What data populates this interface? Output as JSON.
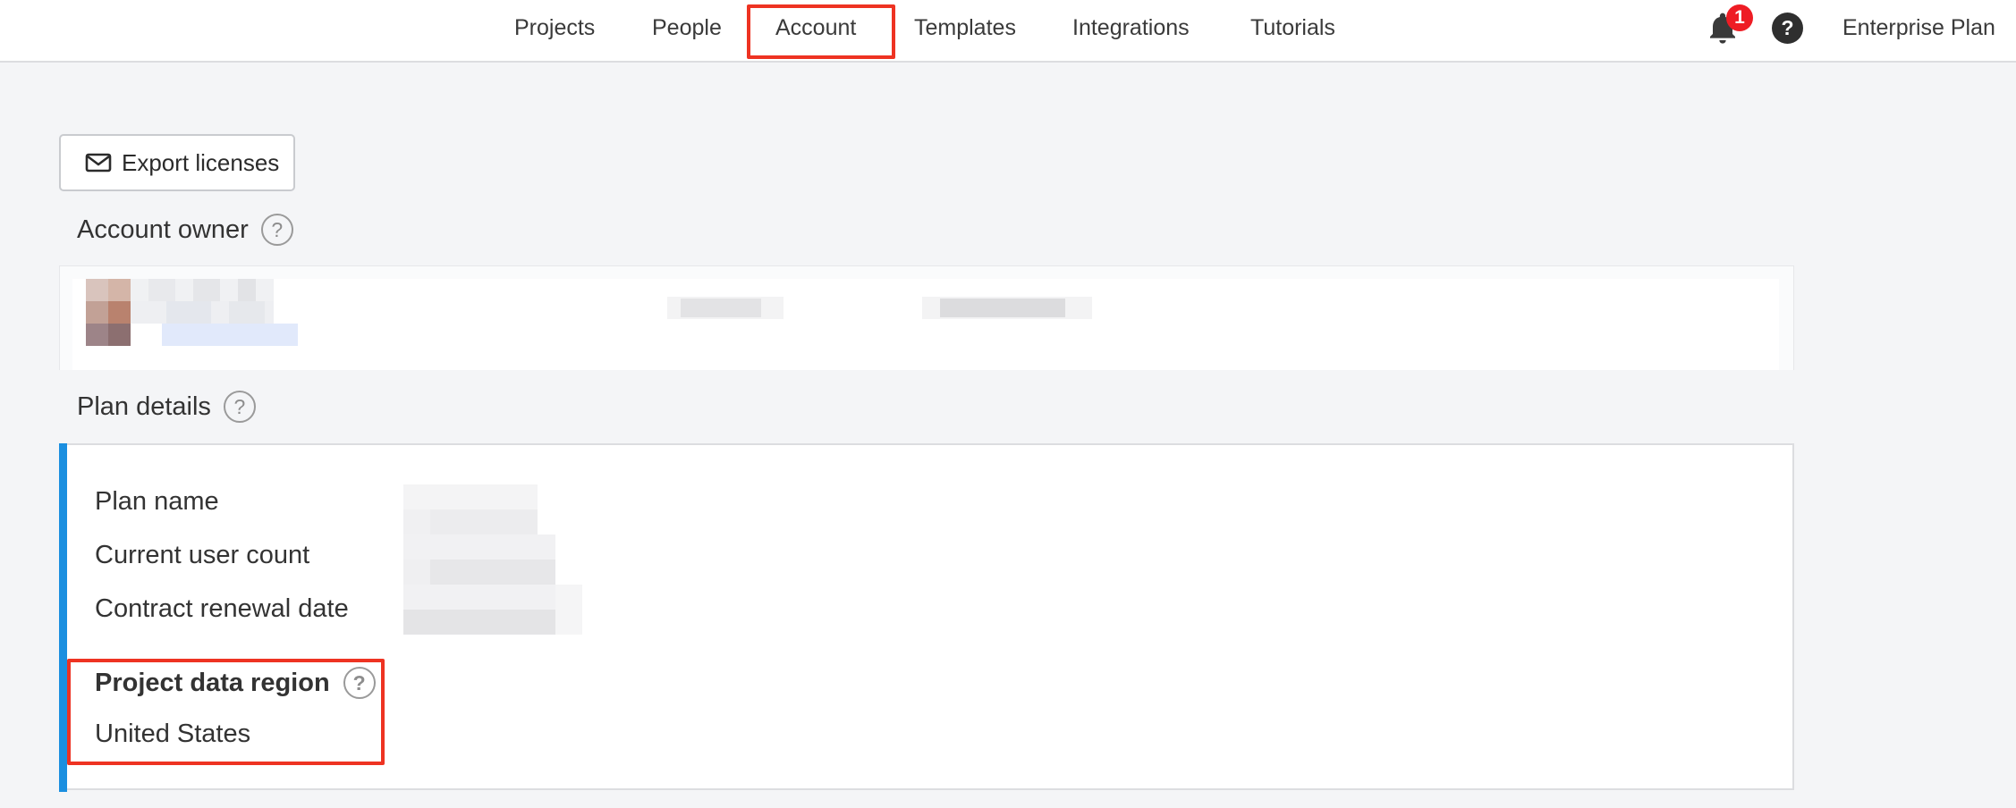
{
  "nav": {
    "items": [
      {
        "label": "Projects"
      },
      {
        "label": "People"
      },
      {
        "label": "Account"
      },
      {
        "label": "Templates"
      },
      {
        "label": "Integrations"
      },
      {
        "label": "Tutorials"
      }
    ],
    "active": "Account",
    "notification_count": "1",
    "help_glyph": "?",
    "plan_label": "Enterprise Plan"
  },
  "export_button": {
    "label": "Export licenses",
    "icon": "mail-icon"
  },
  "account_owner": {
    "title": "Account owner",
    "help_glyph": "?"
  },
  "plan_details": {
    "title": "Plan details",
    "help_glyph": "?",
    "labels": {
      "plan_name": "Plan name",
      "user_count": "Current user count",
      "renewal_date": "Contract renewal date"
    },
    "region_title": "Project data region",
    "region_help_glyph": "?",
    "region_value": "United States"
  },
  "colors": {
    "accent": "#1b8fe0",
    "highlight": "#ee3322",
    "badge": "#ee1c24",
    "background": "#f4f5f7"
  }
}
